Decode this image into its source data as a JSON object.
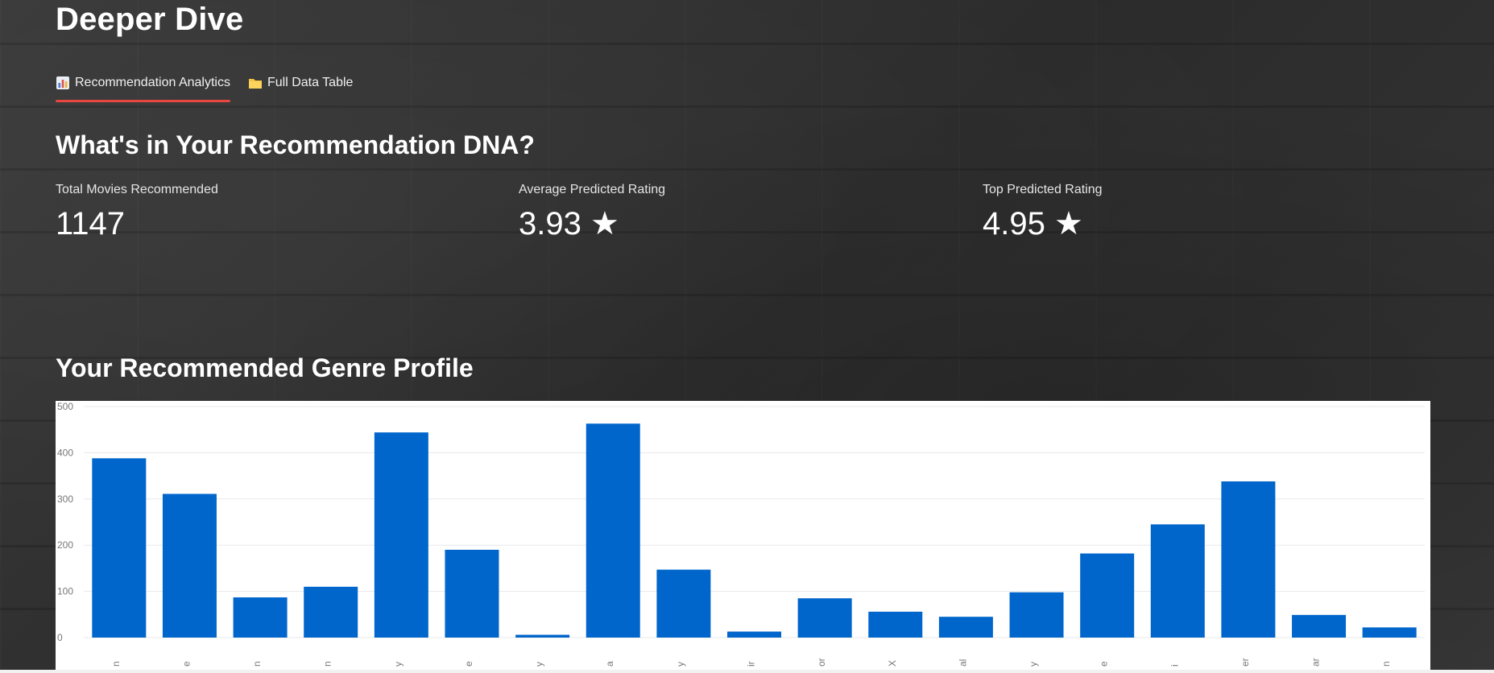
{
  "page": {
    "title": "Deeper Dive"
  },
  "tabs": [
    {
      "icon": "bar-chart-icon",
      "label": "Recommendation Analytics",
      "active": true
    },
    {
      "icon": "folder-icon",
      "label": "Full Data Table",
      "active": false
    }
  ],
  "dna": {
    "heading": "What's in Your Recommendation DNA?",
    "metrics": [
      {
        "label": "Total Movies Recommended",
        "value": "1147"
      },
      {
        "label": "Average Predicted Rating",
        "value": "3.93 ★"
      },
      {
        "label": "Top Predicted Rating",
        "value": "4.95 ★"
      }
    ]
  },
  "genre": {
    "heading": "Your Recommended Genre Profile"
  },
  "colors": {
    "bar": "#0066cc",
    "tab_accent": "#e8463f"
  },
  "chart_data": {
    "type": "bar",
    "x_tick_labels_visible": [
      "n",
      "e",
      "n",
      "n",
      "y",
      "e",
      "y",
      "a",
      "y",
      "ir",
      "or",
      "X",
      "al",
      "y",
      "e",
      "i",
      "er",
      "ar",
      "n"
    ],
    "values": [
      388,
      311,
      87,
      110,
      444,
      190,
      6,
      463,
      147,
      13,
      85,
      56,
      45,
      98,
      182,
      245,
      338,
      49,
      22
    ],
    "ylim": [
      0,
      500
    ],
    "y_ticks": [
      0,
      100,
      200,
      300,
      400,
      500
    ],
    "grid": true,
    "legend": "none"
  }
}
